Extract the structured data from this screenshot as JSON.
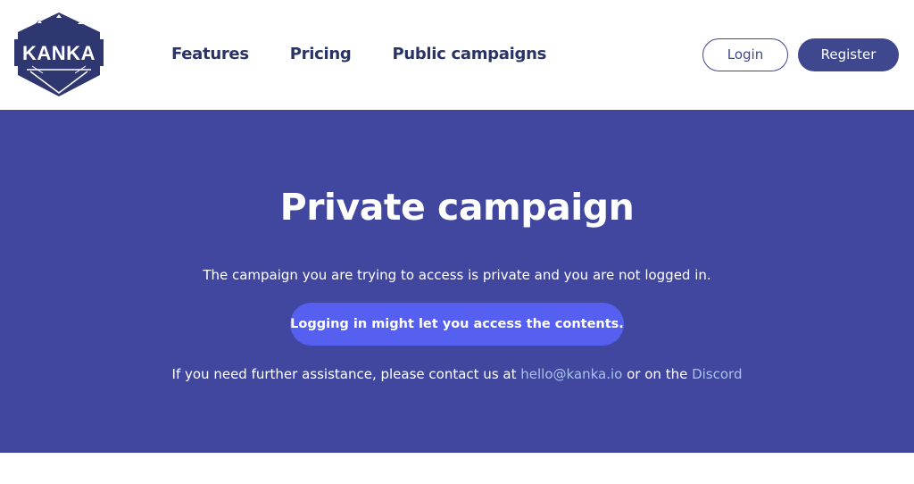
{
  "header": {
    "logo": {
      "text": "KANKA",
      "icon": "kanka-logo-icon"
    },
    "nav": [
      {
        "label": "Features"
      },
      {
        "label": "Pricing"
      },
      {
        "label": "Public campaigns"
      }
    ],
    "login_label": "Login",
    "register_label": "Register"
  },
  "hero": {
    "title": "Private campaign",
    "description": "The campaign you are trying to access is private and you are not logged in.",
    "cta_label": "Logging in might let you access the contents.",
    "help": {
      "prefix": "If you need further assistance, please contact us at ",
      "email": "hello@kanka.io",
      "middle": " or on the ",
      "discord": "Discord"
    }
  },
  "colors": {
    "brand": "#3f478f",
    "hero_bg": "#41479e",
    "cta_bg": "#5560f0",
    "link": "#a7c3ec",
    "nav_text": "#2a3366"
  }
}
